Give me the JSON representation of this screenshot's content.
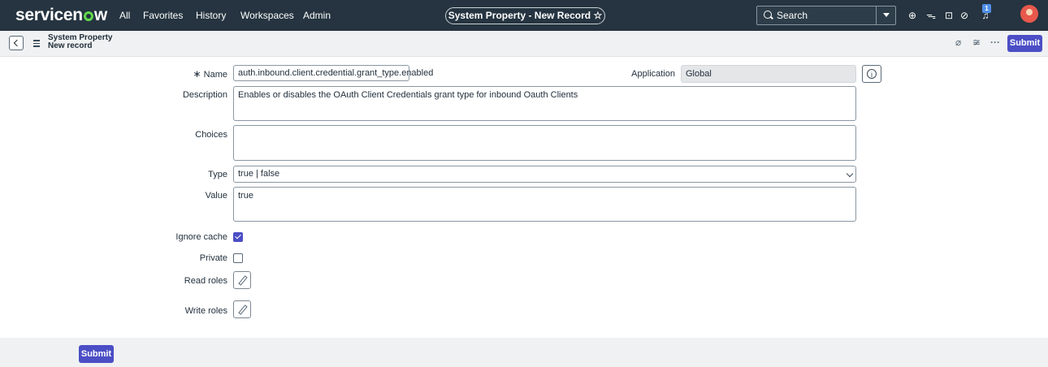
{
  "brand": {
    "prefix": "servicen",
    "suffix": "w"
  },
  "nav": {
    "items": [
      "All",
      "Favorites",
      "History",
      "Workspaces",
      "Admin"
    ]
  },
  "context_pill": "System Property - New Record ☆",
  "search": {
    "placeholder": "Search"
  },
  "notifications": {
    "count": "1"
  },
  "record": {
    "title": "System Property",
    "subtitle": "New record"
  },
  "actions": {
    "submit": "Submit"
  },
  "form": {
    "required_marker": "∗",
    "name_label": "Name",
    "name_value": "auth.inbound.client.credential.grant_type.enabled",
    "application_label": "Application",
    "application_value": "Global",
    "description_label": "Description",
    "description_value": "Enables or disables the OAuth Client Credentials grant type for inbound Oauth Clients",
    "choices_label": "Choices",
    "choices_value": "",
    "type_label": "Type",
    "type_value": "true | false",
    "value_label": "Value",
    "value_value": "true",
    "ignore_cache_label": "Ignore cache",
    "ignore_cache_checked": true,
    "private_label": "Private",
    "private_checked": false,
    "read_roles_label": "Read roles",
    "write_roles_label": "Write roles"
  },
  "colors": {
    "nav_bg": "#253440",
    "accent": "#4b4ec5",
    "logo_green": "#62d84e"
  }
}
